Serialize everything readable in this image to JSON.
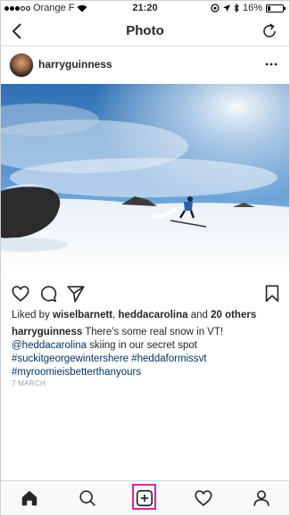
{
  "status_bar": {
    "carrier": "Orange F",
    "time": "21:20",
    "battery": "16%"
  },
  "nav": {
    "title": "Photo"
  },
  "post": {
    "username": "harryguinness",
    "likes_prefix": "Liked by ",
    "likes_user1": "wiselbarnett",
    "likes_sep": ", ",
    "likes_user2": "heddacarolina",
    "likes_and": " and ",
    "likes_others": "20 others",
    "caption_user": "harryguinness",
    "caption_text": " There's some real snow in VT!",
    "caption_mention": "@heddacarolina",
    "caption_text2": " skiing in our secret spot",
    "hashtag1": "#suckitgeorgewintershere",
    "hashtag2": "#heddaformissvt",
    "hashtag3": "#myroomieisbetterthanyours",
    "date": "7 MARCH"
  },
  "colors": {
    "link": "#003569",
    "highlight": "#e0219c"
  }
}
